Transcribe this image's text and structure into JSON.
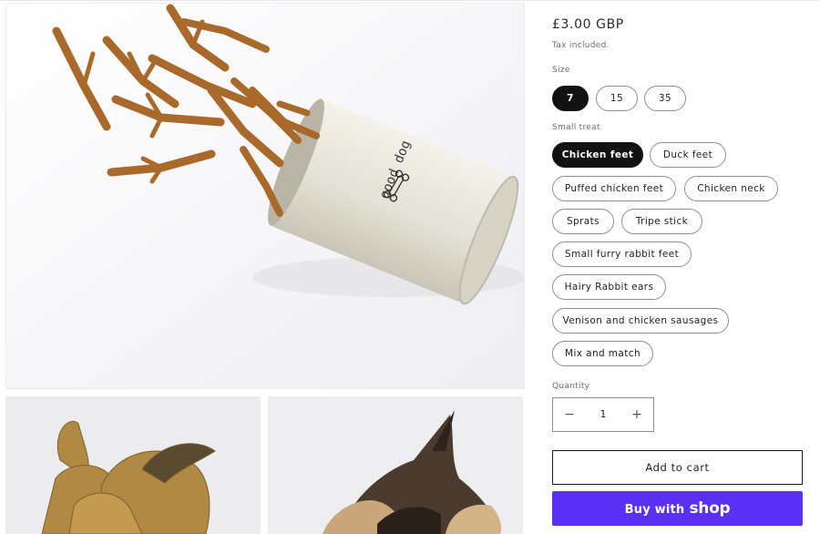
{
  "product": {
    "price": "£3.00 GBP",
    "tax_note": "Tax included.",
    "can_text": "good dog"
  },
  "size": {
    "label": "Size",
    "options": [
      "7",
      "15",
      "35"
    ],
    "selected": "7"
  },
  "small_treat": {
    "label": "Small treat",
    "options": [
      "Chicken feet",
      "Duck feet",
      "Puffed chicken feet",
      "Chicken neck",
      "Sprats",
      "Tripe stick",
      "Small furry rabbit feet",
      "Hairy Rabbit ears",
      "Venison and chicken sausages",
      "Mix and match"
    ],
    "selected": "Chicken feet"
  },
  "quantity": {
    "label": "Quantity",
    "value": "1",
    "minus": "−",
    "plus": "+"
  },
  "buttons": {
    "add_to_cart": "Add to cart",
    "buy_with": "Buy with",
    "shop_brand": "shop"
  },
  "icons": [
    "minus-icon",
    "plus-icon",
    "bone-icon"
  ],
  "colors": {
    "selected_pill": "#121212",
    "shop_pay": "#5a31f4",
    "border": "#8f8f8f"
  }
}
